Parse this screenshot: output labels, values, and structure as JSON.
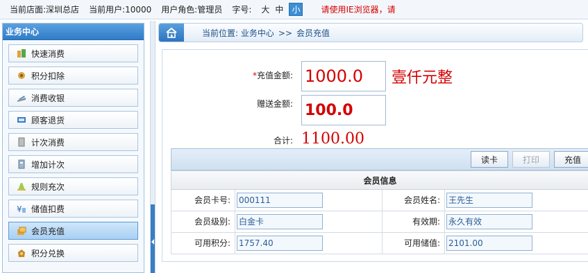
{
  "topbar": {
    "store_label": "当前店面:",
    "store_value": "深圳总店",
    "user_label": "当前用户:",
    "user_value": "10000",
    "role_label": "用户角色:",
    "role_value": "管理员",
    "fontsize_label": "字号:",
    "fontsize_options": [
      "大",
      "中",
      "小"
    ],
    "fontsize_selected": "小",
    "warning": "请使用IE浏览器，请"
  },
  "sidebar": {
    "title": "业务中心",
    "items": [
      {
        "label": "快速消费",
        "icon": "quick-consume-icon"
      },
      {
        "label": "积分扣除",
        "icon": "points-deduct-icon"
      },
      {
        "label": "消费收银",
        "icon": "cashier-icon"
      },
      {
        "label": "顾客退货",
        "icon": "return-icon"
      },
      {
        "label": "计次消费",
        "icon": "count-consume-icon"
      },
      {
        "label": "增加计次",
        "icon": "add-count-icon"
      },
      {
        "label": "规则充次",
        "icon": "rule-recharge-icon"
      },
      {
        "label": "储值扣费",
        "icon": "stored-value-icon"
      },
      {
        "label": "会员充值",
        "icon": "member-recharge-icon",
        "active": true
      },
      {
        "label": "积分兑换",
        "icon": "points-exchange-icon"
      }
    ]
  },
  "breadcrumb": {
    "prefix": "当前位置:",
    "level1": "业务中心",
    "separator": ">>",
    "level2": "会员充值"
  },
  "form": {
    "recharge_required_mark": "*",
    "recharge_label": "充值金额:",
    "recharge_value": "1000.0",
    "recharge_chinese": "壹仟元整",
    "bonus_label": "赠送金额:",
    "bonus_value": "100.0",
    "total_label": "合计:",
    "total_value": "1100.00"
  },
  "toolbar": {
    "read_card": "读卡",
    "print": "打印",
    "recharge": "充值"
  },
  "member_info": {
    "title": "会员信息",
    "card_no_label": "会员卡号:",
    "card_no_value": "000111",
    "name_label": "会员姓名:",
    "name_value": "王先生",
    "level_label": "会员级别:",
    "level_value": "白金卡",
    "validity_label": "有效期:",
    "validity_value": "永久有效",
    "points_label": "可用积分:",
    "points_value": "1757.40",
    "stored_label": "可用储值:",
    "stored_value": "2101.00"
  },
  "colors": {
    "accent": "#2f7cc8",
    "amount_red": "#d40000",
    "field_text": "#2a5d96"
  }
}
